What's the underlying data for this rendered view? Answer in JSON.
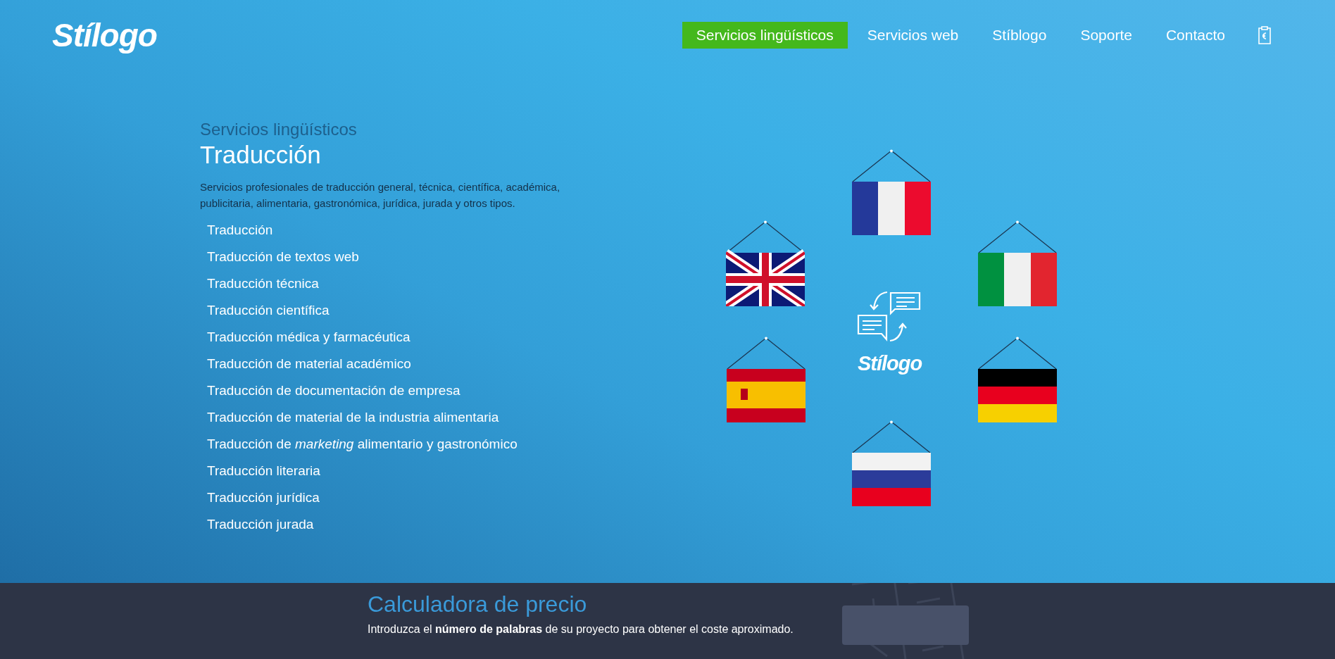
{
  "header": {
    "logo": "Stílogo",
    "nav": [
      {
        "label": "Servicios lingüísticos",
        "selected": true
      },
      {
        "label": "Servicios web",
        "selected": false
      },
      {
        "label": "Stíblogo",
        "selected": false
      },
      {
        "label": "Soporte",
        "selected": false
      },
      {
        "label": "Contacto",
        "selected": false
      }
    ]
  },
  "hero": {
    "eyebrow": "Servicios lingüísticos",
    "title": "Traducción",
    "description": "Servicios profesionales de traducción general, técnica, científica, académica, publicitaria, alimentaria, gastronómica, jurídica, jurada y otros tipos.",
    "links": [
      "Traducción",
      "Traducción de textos web",
      "Traducción técnica",
      "Traducción científica",
      "Traducción médica y farmacéutica",
      "Traducción de material académico",
      "Traducción de documentación de empresa",
      "Traducción de material de la industria alimentaria",
      "Traducción de *marketing* alimentario y gastronómico",
      "Traducción literaria",
      "Traducción jurídica",
      "Traducción jurada"
    ],
    "illustration": {
      "logo": "Stílogo",
      "flags": [
        {
          "kind": "france"
        },
        {
          "kind": "uk"
        },
        {
          "kind": "italy"
        },
        {
          "kind": "spain"
        },
        {
          "kind": "germany"
        },
        {
          "kind": "russia"
        }
      ]
    }
  },
  "calculator": {
    "title": "Calculadora de precio",
    "text": "Introduzca el **número de palabras** de su proyecto para obtener el coste aproximado."
  }
}
